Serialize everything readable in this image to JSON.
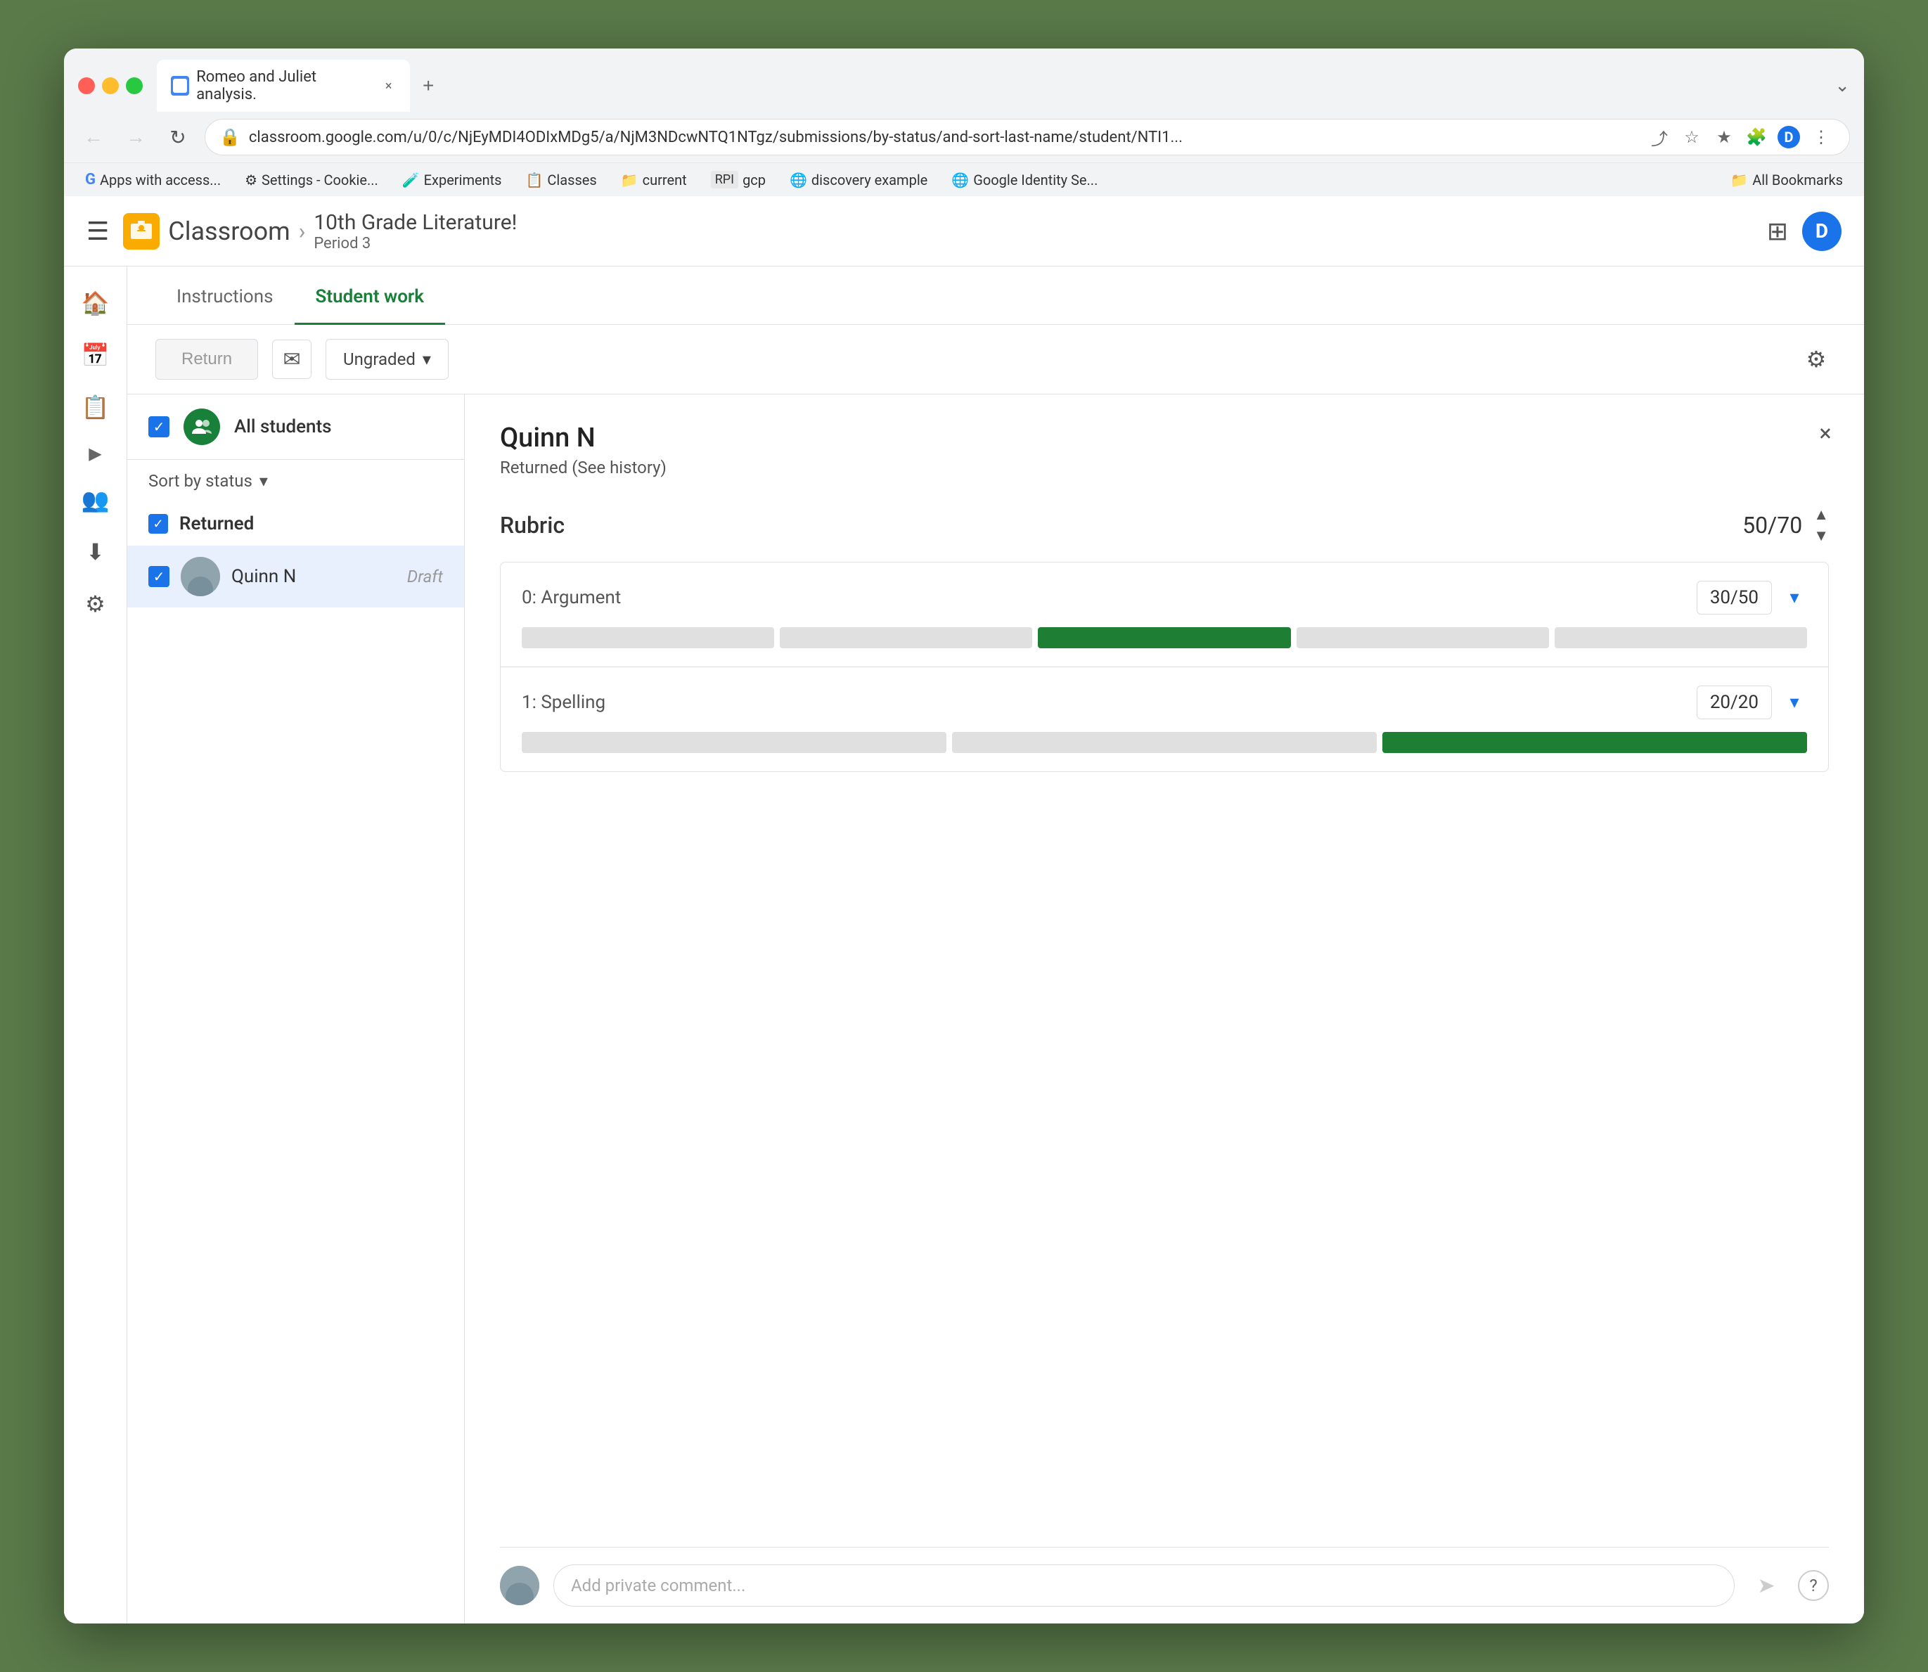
{
  "browser": {
    "tab_title": "Romeo and Juliet analysis.",
    "url": "classroom.google.com/u/0/c/NjEyMDI4ODIxMDg5/a/NjM3NDcwNTQ1NTgz/submissions/by-status/and-sort-last-name/student/NTI1...",
    "new_tab_label": "+",
    "chevron_down": "⌄",
    "back_icon": "←",
    "forward_icon": "→",
    "reload_icon": "↻",
    "lock_icon": "🔒",
    "user_initial": "D",
    "bookmarks": [
      {
        "label": "Apps with access...",
        "icon": "G"
      },
      {
        "label": "Settings - Cookie...",
        "icon": "⚙"
      },
      {
        "label": "Experiments",
        "icon": "🧪"
      },
      {
        "label": "Classes",
        "icon": "📋"
      },
      {
        "label": "current",
        "icon": "📁"
      },
      {
        "label": "gcp",
        "icon": "RPI"
      },
      {
        "label": "discovery example",
        "icon": "🌐"
      },
      {
        "label": "Google Identity Se...",
        "icon": "🌐"
      },
      {
        "label": "All Bookmarks",
        "icon": "📁"
      }
    ]
  },
  "app": {
    "menu_label": "☰",
    "logo_initial": "C",
    "app_name": "Classroom",
    "breadcrumb_sep": "›",
    "course_title": "10th Grade Literature!",
    "course_period": "Period 3",
    "grid_icon": "⊞",
    "user_initial": "D"
  },
  "tabs": {
    "instructions": "Instructions",
    "student_work": "Student work"
  },
  "toolbar": {
    "return_label": "Return",
    "grade_label": "Ungraded",
    "mail_icon": "✉",
    "settings_icon": "⚙",
    "dropdown_icon": "▾"
  },
  "student_list": {
    "all_students_label": "All students",
    "sort_by_label": "Sort by status",
    "sort_dropdown": "▾",
    "sections": [
      {
        "name": "Returned",
        "students": [
          {
            "name": "Quinn N",
            "status": "Draft",
            "selected": true
          }
        ]
      }
    ]
  },
  "detail": {
    "student_name": "Quinn N",
    "student_status": "Returned (See history)",
    "close_icon": "×",
    "rubric_title": "Rubric",
    "rubric_score": "50/70",
    "rubric_up_icon": "▲",
    "rubric_down_icon": "▼",
    "rubric_items": [
      {
        "name": "0: Argument",
        "score": "30/50",
        "expand_icon": "▾",
        "segments": [
          {
            "active": false
          },
          {
            "active": false
          },
          {
            "active": true
          },
          {
            "active": false
          },
          {
            "active": false
          }
        ]
      },
      {
        "name": "1: Spelling",
        "score": "20/20",
        "expand_icon": "▾",
        "segments": [
          {
            "active": false
          },
          {
            "active": false
          },
          {
            "active": true
          }
        ]
      }
    ],
    "comment_placeholder": "Add private comment...",
    "send_icon": "➤",
    "help_icon": "?"
  },
  "sidebar_items": [
    {
      "icon": "🏠",
      "name": "home"
    },
    {
      "icon": "📅",
      "name": "calendar"
    },
    {
      "icon": "📋",
      "name": "assignments"
    },
    {
      "icon": "👥",
      "name": "people",
      "expand": true
    },
    {
      "icon": "⬇",
      "name": "download"
    },
    {
      "icon": "⚙",
      "name": "settings"
    }
  ]
}
